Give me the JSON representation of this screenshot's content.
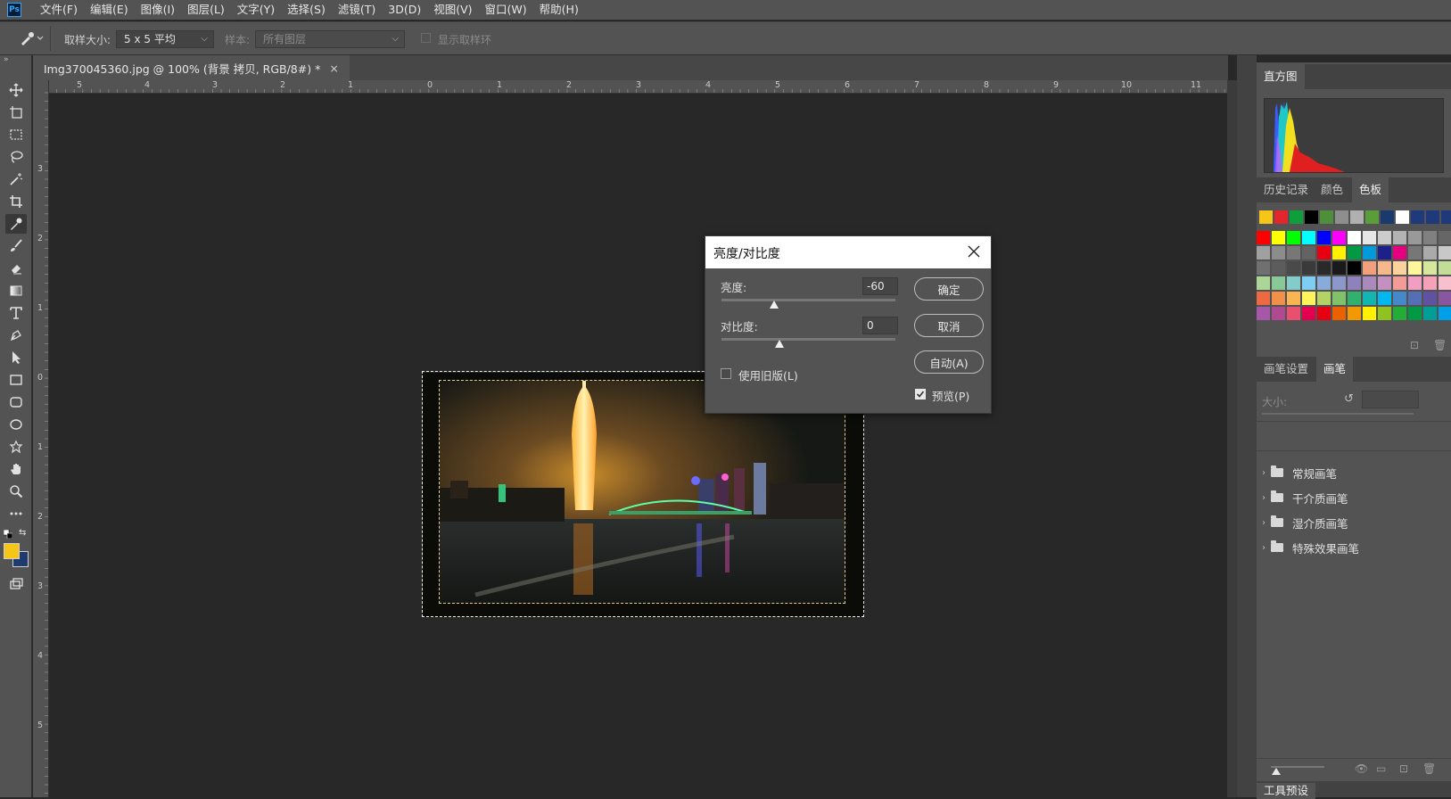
{
  "menu": [
    "文件(F)",
    "编辑(E)",
    "图像(I)",
    "图层(L)",
    "文字(Y)",
    "选择(S)",
    "滤镜(T)",
    "3D(D)",
    "视图(V)",
    "窗口(W)",
    "帮助(H)"
  ],
  "app_logo": "Ps",
  "options": {
    "sample_size_label": "取样大小:",
    "sample_size_value": "5 x 5 平均",
    "sample_label": "样本:",
    "sample_value": "所有图层",
    "show_ring_label": "显示取样环"
  },
  "document": {
    "tab_title": "Img370045360.jpg @ 100% (背景 拷贝, RGB/8#) *",
    "close": "×"
  },
  "ruler_top": [
    "5",
    "4",
    "3",
    "2",
    "1",
    "0",
    "1",
    "2",
    "3",
    "4",
    "5",
    "6",
    "7",
    "8",
    "9",
    "10",
    "11"
  ],
  "ruler_left": [
    "3",
    "2",
    "1",
    "0",
    "1",
    "2",
    "3",
    "4",
    "5"
  ],
  "dialog": {
    "title": "亮度/对比度",
    "brightness_label": "亮度:",
    "brightness_value": "-60",
    "brightness_level": -60,
    "contrast_label": "对比度:",
    "contrast_value": "0",
    "contrast_level": 0,
    "ok": "确定",
    "cancel": "取消",
    "auto": "自动(A)",
    "legacy_label": "使用旧版(L)",
    "legacy_checked": false,
    "preview_label": "预览(P)",
    "preview_checked": true
  },
  "panels": {
    "histogram_tab": "直方图",
    "history_tab": "历史记录",
    "color_tab": "颜色",
    "swatches_tab": "色板",
    "brush_settings_tab": "画笔设置",
    "brushes_tab": "画笔",
    "size_label": "大小:",
    "brush_groups": [
      "常规画笔",
      "干介质画笔",
      "湿介质画笔",
      "特殊效果画笔"
    ],
    "tool_presets_tab": "工具预设"
  },
  "colors": {
    "foreground": "#f5c518",
    "background": "#1f3a6e"
  },
  "swatch_colors": [
    [
      "#f5c518",
      "#e3262d",
      "#109d3c",
      "#000000",
      "#4d8f3a",
      "#8e8e8e",
      "#b0b0b0",
      "#5a9e3c",
      "#1a3a6e",
      "#ffffff",
      "#1e3a7a",
      "#1e3a7a",
      "#1e3a7a"
    ],
    [
      "#ff0000",
      "#ffff00",
      "#00ff00",
      "#00ffff",
      "#0000ff",
      "#ff00ff",
      "#ffffff",
      "#e6e6e6",
      "#cccccc",
      "#b3b3b3",
      "#999999",
      "#808080",
      "#666666"
    ],
    [
      "#a0a0a0",
      "#8c8c8c",
      "#777777",
      "#636363",
      "#e60012",
      "#fff100",
      "#009944",
      "#0099d9",
      "#1d2088",
      "#e4007f",
      "#777777",
      "#aaaaaa",
      "#c8c8c8"
    ],
    [
      "#707070",
      "#5c5c5c",
      "#4a4a4a",
      "#3a3a3a",
      "#2a2a2a",
      "#1a1a1a",
      "#000000",
      "#f19f7c",
      "#f6b78c",
      "#fad29c",
      "#fff59a",
      "#d6e79c",
      "#c1dd97"
    ],
    [
      "#acd598",
      "#89c997",
      "#84ccc9",
      "#7ecef4",
      "#88abda",
      "#8c97cb",
      "#8f82bc",
      "#aa89bd",
      "#c490bf",
      "#f29b97",
      "#f19ec2",
      "#f5a2b8",
      "#f8c0cf"
    ],
    [
      "#ec6941",
      "#f19149",
      "#f8b551",
      "#fff45c",
      "#b3d465",
      "#80c269",
      "#32b16c",
      "#13b5b1",
      "#00b7ee",
      "#448aca",
      "#556fb5",
      "#5f52a0",
      "#8957a1"
    ],
    [
      "#a757a8",
      "#af4a92",
      "#e94f6f",
      "#e5004f",
      "#e60012",
      "#eb6100",
      "#f39800",
      "#fff100",
      "#8fc31f",
      "#22ac38",
      "#009944",
      "#009e96",
      "#00a0e9"
    ]
  ]
}
